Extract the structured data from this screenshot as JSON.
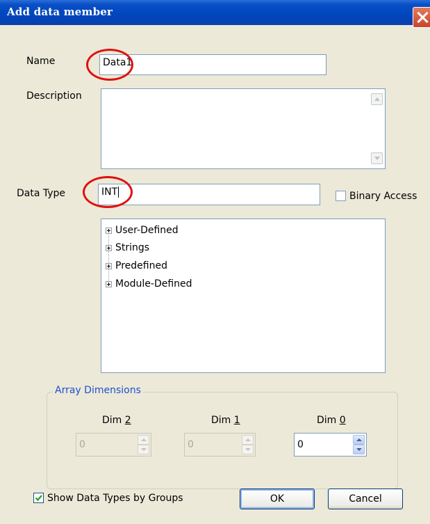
{
  "window": {
    "title": "Add data member"
  },
  "form": {
    "name_label": "Name",
    "name_value": "Data1",
    "description_label": "Description",
    "description_value": "",
    "datatype_label": "Data Type",
    "datatype_value": "INT",
    "binary_access_label": "Binary Access",
    "binary_access_checked": false
  },
  "tree": {
    "items": [
      {
        "label": "User-Defined"
      },
      {
        "label": "Strings"
      },
      {
        "label": "Predefined"
      },
      {
        "label": "Module-Defined"
      }
    ]
  },
  "array_dimensions": {
    "legend": "Array Dimensions",
    "dims": [
      {
        "label_prefix": "Dim ",
        "label_accel": "2",
        "value": "0",
        "enabled": false
      },
      {
        "label_prefix": "Dim ",
        "label_accel": "1",
        "value": "0",
        "enabled": false
      },
      {
        "label_prefix": "Dim ",
        "label_accel": "0",
        "value": "0",
        "enabled": true
      }
    ]
  },
  "footer": {
    "show_groups_label": "Show Data Types by Groups",
    "show_groups_checked": true,
    "ok_label": "OK",
    "cancel_label": "Cancel"
  },
  "colors": {
    "annotation_circle": "#e01010",
    "titlebar": "#0047be",
    "group_legend": "#1f4fcf"
  }
}
